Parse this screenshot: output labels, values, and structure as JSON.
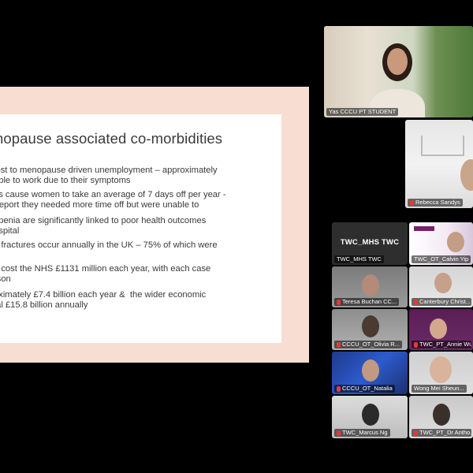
{
  "slide": {
    "title": "nopause associated co-morbidities",
    "bullets": [
      "lost to menopause driven unemployment – approximately\nable to work due to their symptoms",
      "ns cause women to take an average of 7 days off per year -\n report they needed more time off but were unable to",
      "openia are significantly linked to poor health outcomes\nospital",
      "o fractures occur annually in the UK – 75% of which were",
      "e cost the NHS £1131 million each year, with each case\nrson",
      "oximately £7.4 billion each year &  the wider economic\ntal £15.8 billion annually"
    ]
  },
  "participants": {
    "featured": [
      {
        "name": "Yas CCCU PT STUDENT"
      },
      {
        "name": "Rebecca Sandys"
      }
    ],
    "grid": [
      {
        "name": "TWC_MHS TWC",
        "label": "TWC_MHS TWC"
      },
      {
        "name": "TWC_OT_Calvin Yip"
      },
      {
        "name": "Teresa Buchan CC..."
      },
      {
        "name": "Canterbury Christ..."
      },
      {
        "name": "CCCU_OT_Olivia R..."
      },
      {
        "name": "TWC_PT_Annie Wu"
      },
      {
        "name": "CCCU_OT_Natalia"
      },
      {
        "name": "Wong Mei Sheun..."
      },
      {
        "name": "TWC_Marcus Ng"
      },
      {
        "name": "TWC_PT_Dr Antho..."
      }
    ]
  },
  "colors": {
    "slide_background": "#f7ddd2",
    "active_speaker_outline": "#4caf50",
    "muted_mic": "#e53935"
  }
}
